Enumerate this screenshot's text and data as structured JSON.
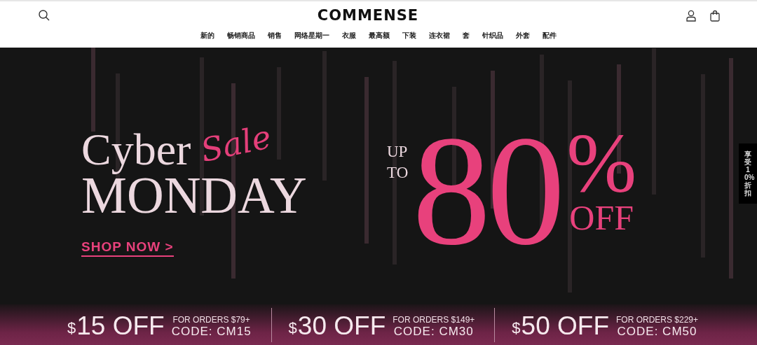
{
  "header": {
    "logo": "COMMENSE",
    "nav": [
      "新的",
      "畅销商品",
      "销售",
      "网络星期一",
      "衣服",
      "最高额",
      "下装",
      "连衣裙",
      "套",
      "针织品",
      "外套",
      "配件"
    ]
  },
  "banner": {
    "title_line_1": "Cyber",
    "script": "Sale",
    "title_line_2": "MONDAY",
    "link": "SHOP NOW >",
    "prefix_1": "UP",
    "prefix_2": "TO",
    "amount": "80",
    "percent": "%",
    "suffix": "OFF"
  },
  "coupons": [
    {
      "currency": "$",
      "amount": "15 OFF",
      "condition": "FOR ORDERS $79+",
      "code": "CODE: CM15"
    },
    {
      "currency": "$",
      "amount": "30 OFF",
      "condition": "FOR ORDERS $149+",
      "code": "CODE: CM30"
    },
    {
      "currency": "$",
      "amount": "50 OFF",
      "condition": "FOR ORDERS $229+",
      "code": "CODE: CM50"
    }
  ],
  "side_tab": "享受10%折扣"
}
